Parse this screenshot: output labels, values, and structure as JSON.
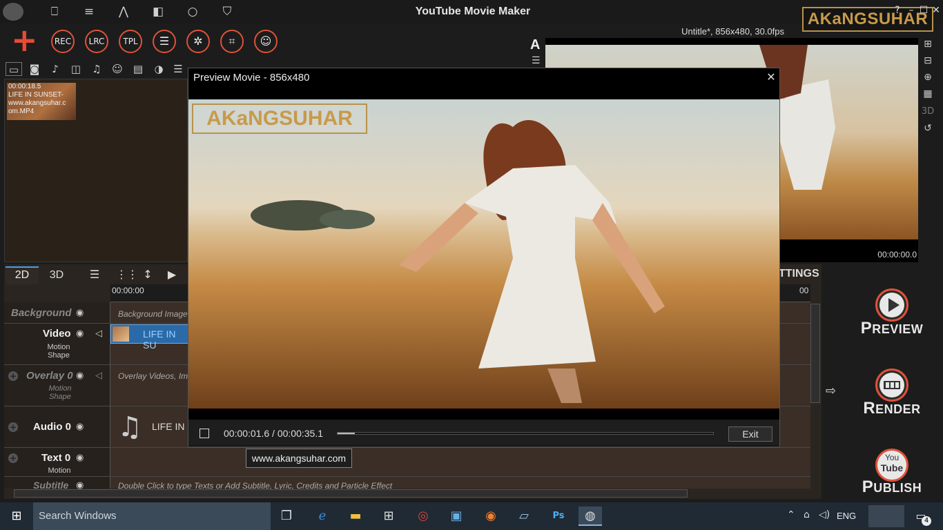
{
  "app": {
    "title": "YouTube Movie Maker"
  },
  "window_controls": {
    "help": "?",
    "minimize": "–",
    "maximize": "☐",
    "close": "✕"
  },
  "toolbar": {
    "add": "+",
    "buttons": [
      {
        "label": "REC"
      },
      {
        "label": "LRC"
      },
      {
        "label": "TPL"
      },
      {
        "label": "☰"
      },
      {
        "label": "✲"
      },
      {
        "label": "⌗"
      },
      {
        "label": "☺"
      }
    ]
  },
  "media": {
    "clip": {
      "line1": "00:00:18.5",
      "line2": "LIFE IN SUNSET-",
      "line3": "www.akangsuhar.c",
      "line4": "om.MP4"
    }
  },
  "project": {
    "info": "Untitle*, 856x480, 30.0fps"
  },
  "logo": {
    "text": "AKaNGSUHAR"
  },
  "preview_pane": {
    "time": "00:00:00.0"
  },
  "timeline": {
    "tabs": [
      "2D",
      "3D"
    ],
    "ruler_start": "00:00:00",
    "ruler_end": "00",
    "tracks": {
      "background": {
        "name": "Background",
        "hint": "Background Image"
      },
      "video": {
        "name": "Video",
        "sub1": "Motion",
        "sub2": "Shape",
        "clip_label": "LIFE IN SU"
      },
      "overlay": {
        "name": "Overlay 0",
        "sub1": "Motion",
        "sub2": "Shape",
        "hint": "Overlay Videos, Im"
      },
      "audio": {
        "name": "Audio 0",
        "clip_label": "LIFE IN"
      },
      "text": {
        "name": "Text 0",
        "sub1": "Motion"
      },
      "subtitle": {
        "name": "Subtitle",
        "hint": "Double Click to type Texts or Add Subtitle, Lyric, Credits and Particle Effect"
      }
    }
  },
  "settings_partial": "TTINGS",
  "actions": {
    "preview": {
      "initial": "P",
      "rest": "REVIEW"
    },
    "render": {
      "initial": "R",
      "rest": "ENDER"
    },
    "publish": {
      "initial": "P",
      "rest": "UBLISH",
      "icon_top": "You",
      "icon_bottom": "Tube"
    }
  },
  "dialog": {
    "title": "Preview Movie - 856x480",
    "time": "00:00:01.6 / 00:00:35.1",
    "progress": 0.046,
    "exit_label": "Exit",
    "tooltip": "www.akangsuhar.com"
  },
  "taskbar": {
    "search_placeholder": "Search Windows",
    "language": "ENG",
    "notifications": "4"
  }
}
